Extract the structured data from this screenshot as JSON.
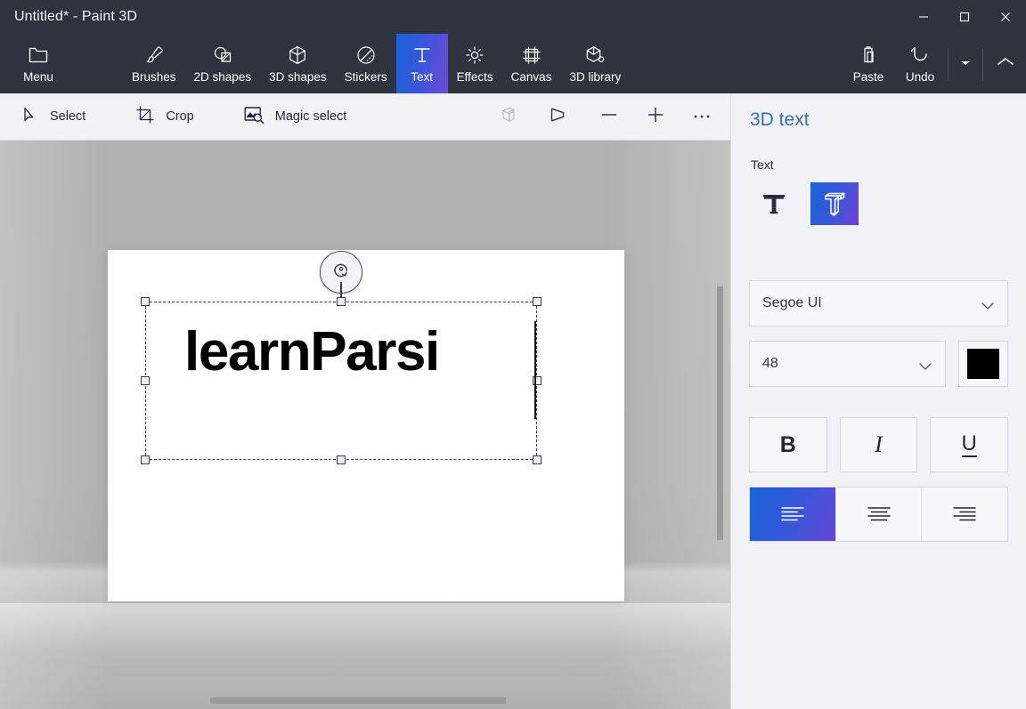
{
  "window": {
    "title": "Untitled* - Paint 3D",
    "controls": [
      {
        "name": "minimize",
        "label": "Minimize"
      },
      {
        "name": "maximize",
        "label": "Maximize"
      },
      {
        "name": "close",
        "label": "Close"
      }
    ]
  },
  "ribbon": {
    "menu": {
      "label": "Menu",
      "icon": "folder-icon"
    },
    "tools": [
      {
        "label": "Brushes",
        "icon": "brush-icon",
        "active": false
      },
      {
        "label": "2D shapes",
        "icon": "2d-shapes-icon",
        "active": false
      },
      {
        "label": "3D shapes",
        "icon": "3d-shapes-icon",
        "active": false
      },
      {
        "label": "Stickers",
        "icon": "stickers-icon",
        "active": false
      },
      {
        "label": "Text",
        "icon": "text-icon",
        "active": true
      },
      {
        "label": "Effects",
        "icon": "effects-icon",
        "active": false
      },
      {
        "label": "Canvas",
        "icon": "canvas-icon",
        "active": false
      },
      {
        "label": "3D library",
        "icon": "3d-library-icon",
        "active": false
      }
    ],
    "actions": [
      {
        "label": "Paste",
        "icon": "clipboard-icon"
      },
      {
        "label": "Undo",
        "icon": "undo-icon"
      }
    ],
    "more_dropdown_icon": "chevron-down-icon",
    "collapse_icon": "chevron-up-icon"
  },
  "subbar": {
    "tools": [
      {
        "label": "Select",
        "icon": "cursor-arrow-icon"
      },
      {
        "label": "Crop",
        "icon": "crop-icon"
      },
      {
        "label": "Magic select",
        "icon": "magic-select-icon"
      }
    ],
    "view_icons": [
      {
        "name": "3d-view-icon",
        "disabled": true
      },
      {
        "name": "perspective-icon",
        "disabled": false
      },
      {
        "name": "zoom-out-icon",
        "disabled": false
      },
      {
        "name": "zoom-in-icon",
        "disabled": false
      },
      {
        "name": "more-options-icon",
        "disabled": false
      }
    ]
  },
  "canvas": {
    "text_value": "learnParsi",
    "selection": {
      "rotate_handle_icon": "rotate-icon",
      "handles": 8
    },
    "background_color": "#b0b0b0",
    "paper_color": "#ffffff"
  },
  "panel": {
    "title": "3D text",
    "text_section_label": "Text",
    "type_options": [
      {
        "name": "2d-text-option",
        "label": "2D text",
        "selected": false
      },
      {
        "name": "3d-text-option",
        "label": "3D text",
        "selected": true
      }
    ],
    "font": {
      "value": "Segoe UI",
      "placeholder": "Segoe UI"
    },
    "size": {
      "value": "48",
      "placeholder": "48"
    },
    "color": {
      "value": "#000000",
      "label": "Text color"
    },
    "styles": [
      {
        "name": "bold-button",
        "glyph": "B",
        "active": false
      },
      {
        "name": "italic-button",
        "glyph": "I",
        "active": false
      },
      {
        "name": "underline-button",
        "glyph": "U",
        "active": false
      }
    ],
    "alignment": [
      {
        "name": "align-left-button",
        "label": "Align left",
        "selected": true
      },
      {
        "name": "align-center-button",
        "label": "Align center",
        "selected": false
      },
      {
        "name": "align-right-button",
        "label": "Align right",
        "selected": false
      }
    ]
  },
  "colors": {
    "titlebar": "#2f333d",
    "accent_start": "#1565d8",
    "accent_end": "#6d4bd8",
    "panel_bg": "#f2f2f6",
    "panel_title": "#2f6fb5"
  }
}
